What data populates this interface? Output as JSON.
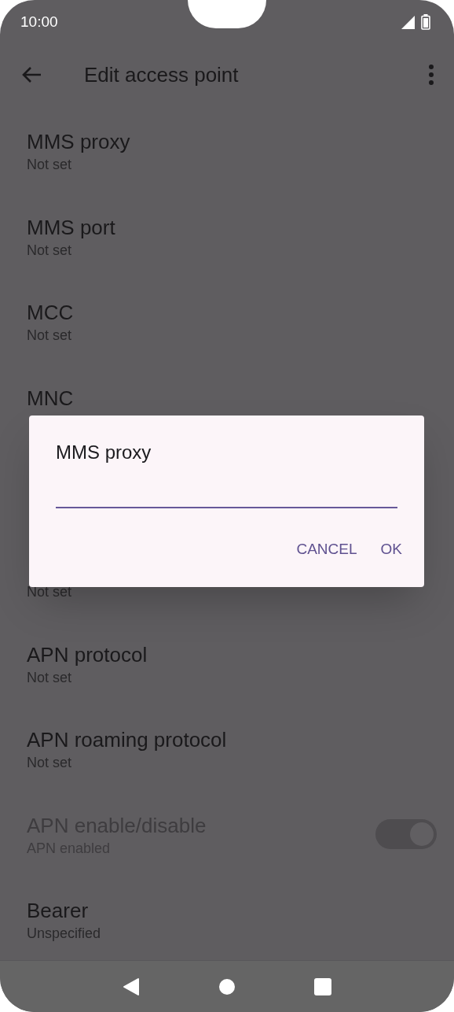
{
  "status_bar": {
    "time": "10:00"
  },
  "toolbar": {
    "title": "Edit access point"
  },
  "rows": [
    {
      "title": "MMS proxy",
      "subtitle": "Not set",
      "disabled": false
    },
    {
      "title": "MMS port",
      "subtitle": "Not set",
      "disabled": false
    },
    {
      "title": "MCC",
      "subtitle": "Not set",
      "disabled": false
    },
    {
      "title": "MNC",
      "disabled": false
    },
    {},
    {
      "subtitle": "Not set",
      "disabled": false
    },
    {
      "title": "APN protocol",
      "subtitle": "Not set",
      "disabled": false
    },
    {
      "title": "APN roaming protocol",
      "subtitle": "Not set",
      "disabled": false
    },
    {
      "title": "APN enable/disable",
      "subtitle": "APN enabled",
      "disabled": true,
      "kind": "switch",
      "on": true
    },
    {
      "title": "Bearer",
      "subtitle": "Unspecified",
      "disabled": false
    }
  ],
  "dialog": {
    "title": "MMS proxy",
    "buttons": [
      "CANCEL",
      "OK"
    ]
  }
}
